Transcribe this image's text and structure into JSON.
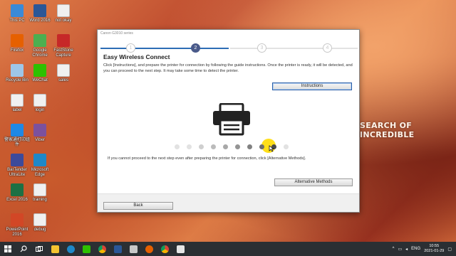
{
  "desktop": {
    "icons": [
      {
        "label": "This PC",
        "icon": "computer-icon",
        "color": "#3a8ad8"
      },
      {
        "label": "Word 2016",
        "icon": "word-icon",
        "color": "#2b5797"
      },
      {
        "label": "not okay",
        "icon": "file-icon",
        "color": "#f0f0f0"
      },
      {
        "label": "Firefox",
        "icon": "firefox-icon",
        "color": "#e66000"
      },
      {
        "label": "Google Chrome",
        "icon": "chrome-icon",
        "color": "#4caf50"
      },
      {
        "label": "FastStone Capture",
        "icon": "capture-icon",
        "color": "#c62828"
      },
      {
        "label": "Recycle Bin",
        "icon": "recycle-bin-icon",
        "color": "#9ec6e8"
      },
      {
        "label": "WeChat",
        "icon": "wechat-icon",
        "color": "#2dc100"
      },
      {
        "label": "sales",
        "icon": "document-icon",
        "color": "#f0f0f0"
      },
      {
        "label": "label",
        "icon": "document-icon",
        "color": "#f0f0f0"
      },
      {
        "label": "login",
        "icon": "document-icon",
        "color": "#f0f0f0"
      },
      {
        "label": "警家通打印组件",
        "icon": "printer-app-icon",
        "color": "#1e88e5"
      },
      {
        "label": "Viber",
        "icon": "viber-icon",
        "color": "#7b519d"
      },
      {
        "label": "BarTender UltraLite",
        "icon": "bartender-icon",
        "color": "#3c4a9a"
      },
      {
        "label": "Microsoft Edge",
        "icon": "edge-icon",
        "color": "#1e88c8"
      },
      {
        "label": "Excel 2016",
        "icon": "excel-icon",
        "color": "#1d7044"
      },
      {
        "label": "training",
        "icon": "document-icon",
        "color": "#f0f0f0"
      },
      {
        "label": "PowerPoint 2016",
        "icon": "powerpoint-icon",
        "color": "#d24726"
      },
      {
        "label": "debug",
        "icon": "document-icon",
        "color": "#f0f0f0"
      }
    ]
  },
  "wallpaper": {
    "text": "SEARCH OF INCREDIBLE"
  },
  "dialog": {
    "title": "Canon G3010 series",
    "steps": [
      {
        "label": "1",
        "state": "done"
      },
      {
        "label": "2",
        "state": "active"
      },
      {
        "label": "3",
        "state": "pending"
      },
      {
        "label": "4",
        "state": "pending"
      }
    ],
    "heading": "Easy Wireless Connect",
    "instructions_text": "Click [Instructions], and prepare the printer for connection by following the guide instructions. Once the printer is ready, it will be detected, and you can proceed to the next step. It may take some time to detect the printer.",
    "instructions_button": "Instructions",
    "progress_dots": 10,
    "progress_active": 9,
    "note": "If you cannot proceed to the next step even after preparing the printer for connection, click [Alternative Methods].",
    "alt_button": "Alternative Methods",
    "back_button": "Back"
  },
  "taskbar": {
    "items": [
      "start-icon",
      "search-icon",
      "task-view-icon",
      "file-explorer-icon",
      "edge-icon",
      "wechat-icon",
      "chrome-icon",
      "word-icon",
      "printer-icon",
      "firefox-icon",
      "chrome-icon",
      "canon-icon"
    ],
    "tray": {
      "language": "ENG",
      "time": "10:55",
      "date": "2021-01-29"
    }
  }
}
